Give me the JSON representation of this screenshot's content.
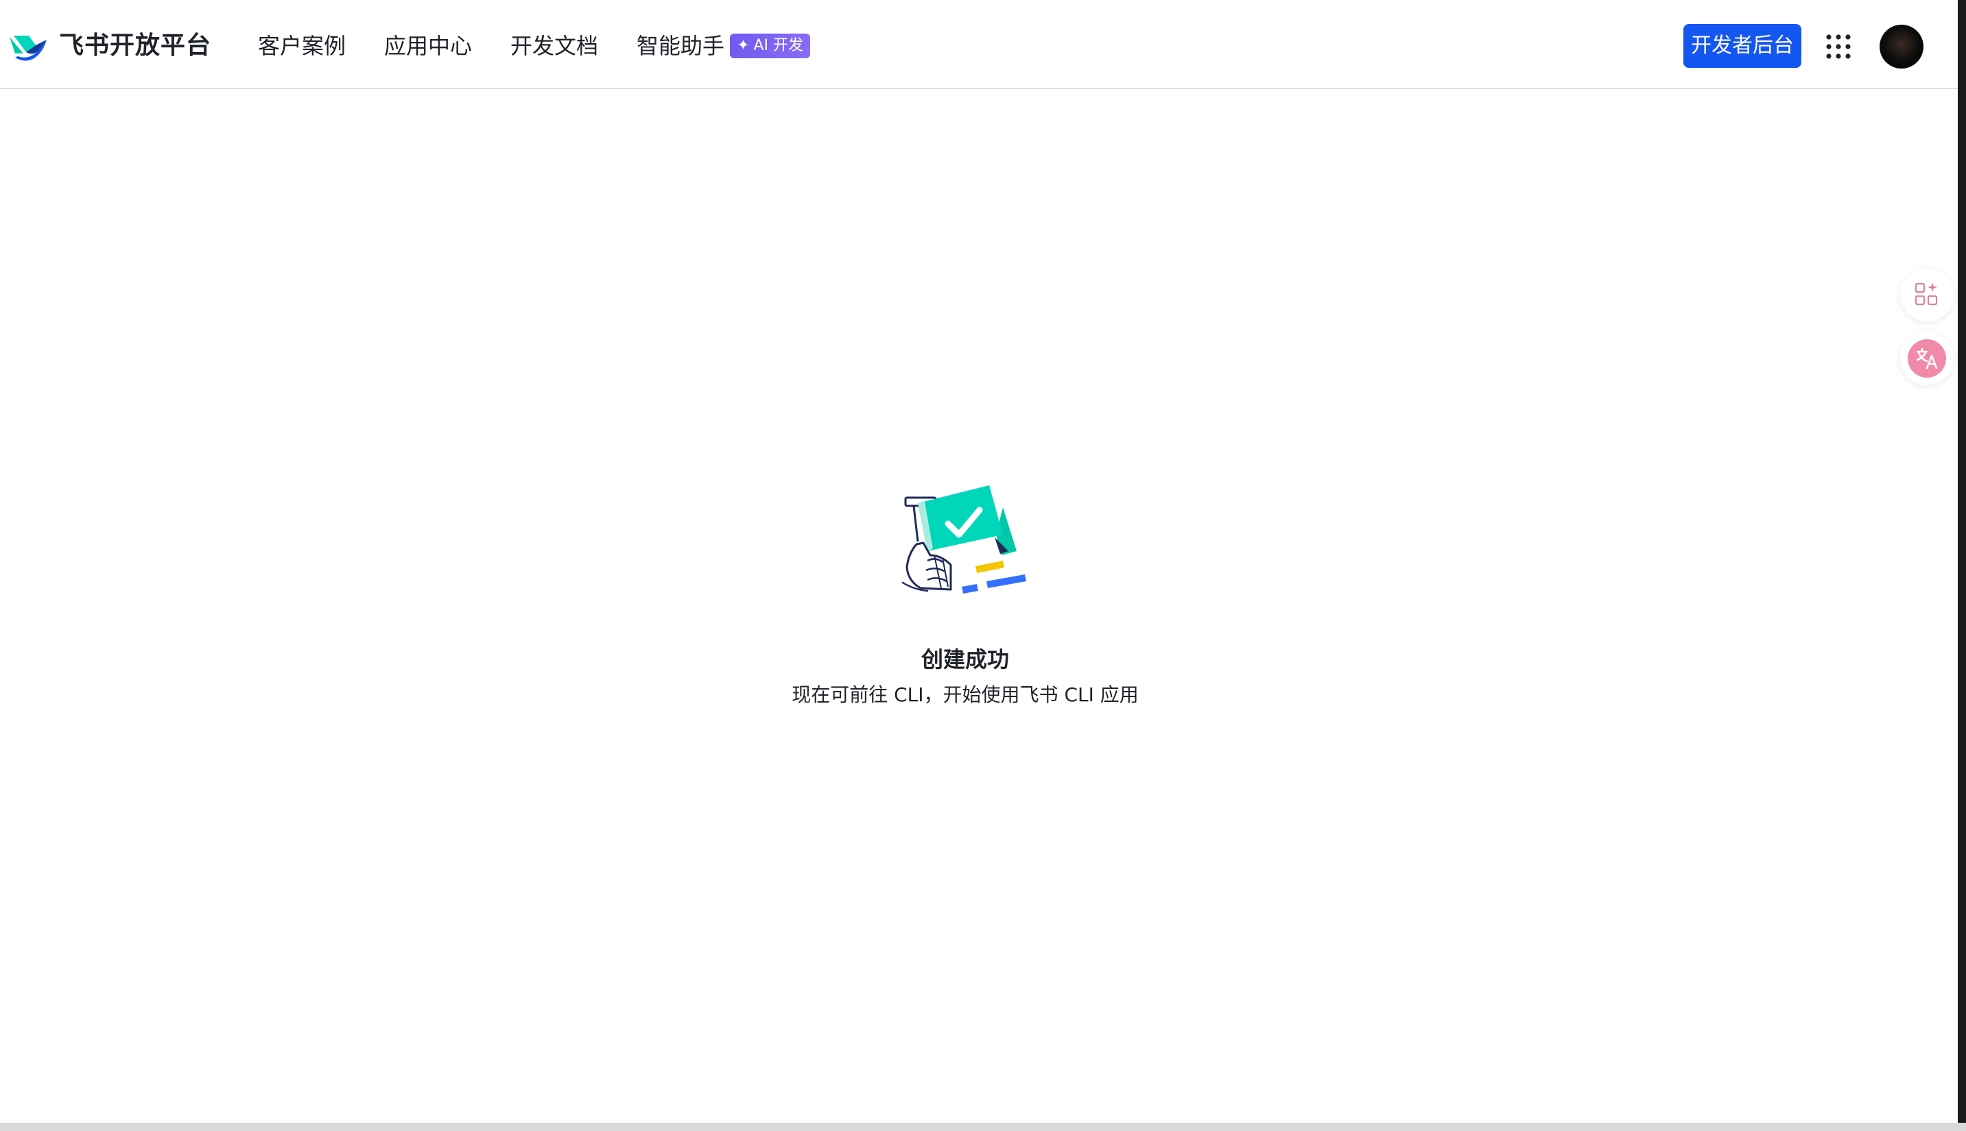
{
  "brand": {
    "name": "飞书开放平台",
    "colors": {
      "blue": "#1456f0",
      "teal": "#00c8a8",
      "dark": "#1f2329"
    }
  },
  "nav": {
    "items": [
      {
        "label": "客户案例"
      },
      {
        "label": "应用中心"
      },
      {
        "label": "开发文档"
      },
      {
        "label": "智能助手",
        "badge": "AI 开发"
      }
    ]
  },
  "header": {
    "developer_console_label": "开发者后台",
    "apps_icon": "grid-dots-icon",
    "avatar": "user-avatar"
  },
  "floating_tools": [
    {
      "icon": "ai-apps-icon"
    },
    {
      "icon": "translate-icon"
    }
  ],
  "result": {
    "title": "创建成功",
    "description": "现在可前往 CLI，开始使用飞书 CLI 应用",
    "illustration": "success-checkmark-illustration"
  }
}
